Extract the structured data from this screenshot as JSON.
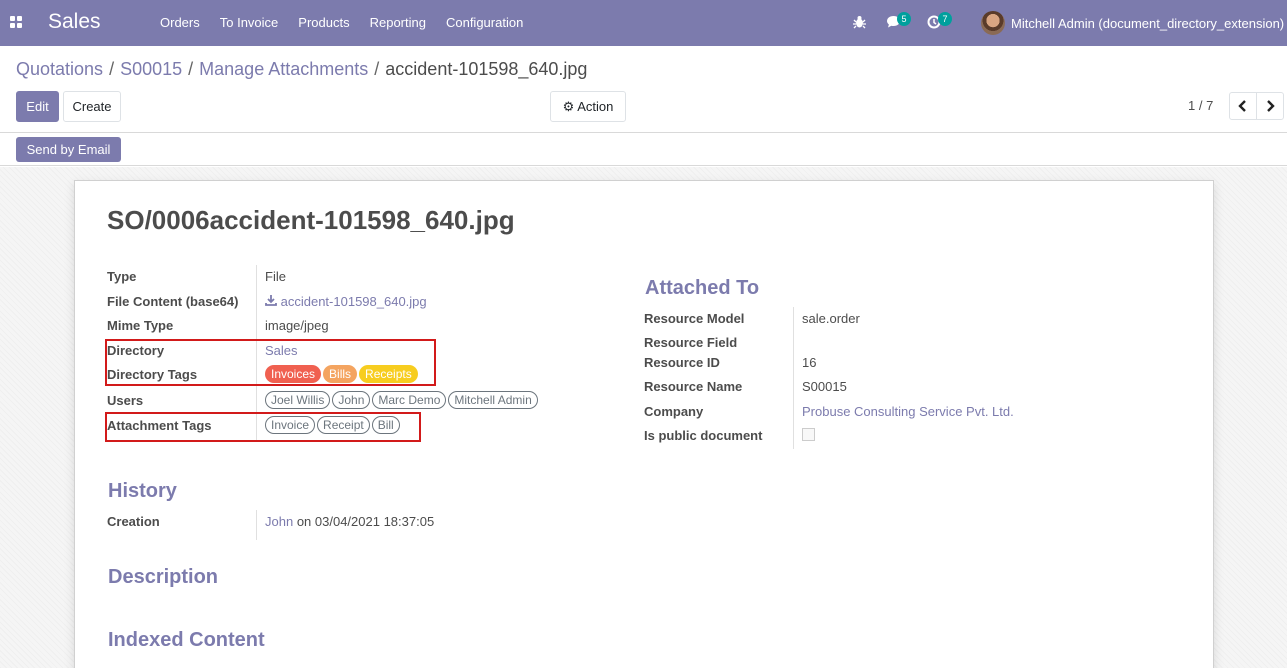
{
  "navbar": {
    "brand": "Sales",
    "menu": [
      "Orders",
      "To Invoice",
      "Products",
      "Reporting",
      "Configuration"
    ],
    "messages_count": "5",
    "activities_count": "7",
    "user": "Mitchell Admin (document_directory_extension)"
  },
  "breadcrumb": {
    "items": [
      "Quotations",
      "S00015",
      "Manage Attachments"
    ],
    "current": "accident-101598_640.jpg"
  },
  "buttons": {
    "edit": "Edit",
    "create": "Create",
    "action": "Action",
    "send_email": "Send by Email"
  },
  "pager": {
    "value": "1 / 7"
  },
  "record": {
    "title": "SO/0006accident-101598_640.jpg",
    "left": {
      "type_label": "Type",
      "type_value": "File",
      "content_label": "File Content (base64)",
      "content_value": "accident-101598_640.jpg",
      "mime_label": "Mime Type",
      "mime_value": "image/jpeg",
      "directory_label": "Directory",
      "directory_value": "Sales",
      "dir_tags_label": "Directory Tags",
      "dir_tags": [
        {
          "name": "Invoices",
          "color": "#f06050"
        },
        {
          "name": "Bills",
          "color": "#f4a460"
        },
        {
          "name": "Receipts",
          "color": "#f7cd1f"
        }
      ],
      "users_label": "Users",
      "users": [
        "Joel Willis",
        "John",
        "Marc Demo",
        "Mitchell Admin"
      ],
      "att_tags_label": "Attachment Tags",
      "att_tags": [
        "Invoice",
        "Receipt",
        "Bill"
      ]
    },
    "attached": {
      "heading": "Attached To",
      "model_label": "Resource Model",
      "model_value": "sale.order",
      "field_label": "Resource Field",
      "id_label": "Resource ID",
      "id_value": "16",
      "name_label": "Resource Name",
      "name_value": "S00015",
      "company_label": "Company",
      "company_value": "Probuse Consulting Service Pvt. Ltd.",
      "public_label": "Is public document"
    },
    "history": {
      "heading": "History",
      "creation_label": "Creation",
      "creation_user": "John",
      "creation_rest": "on 03/04/2021 18:37:05"
    },
    "description_heading": "Description",
    "indexed_heading": "Indexed Content"
  }
}
